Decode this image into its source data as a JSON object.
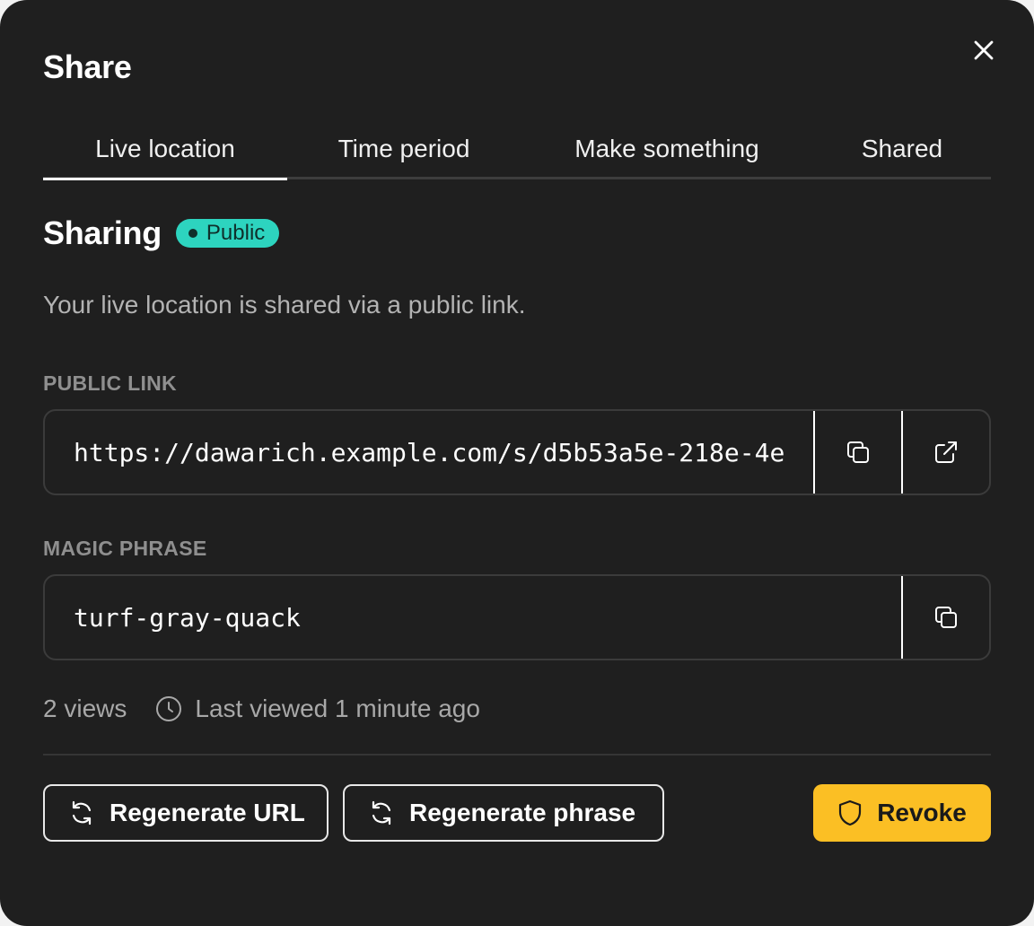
{
  "dialog": {
    "title": "Share"
  },
  "tabs": [
    {
      "label": "Live location",
      "active": true
    },
    {
      "label": "Time period",
      "active": false
    },
    {
      "label": "Make something",
      "active": false
    },
    {
      "label": "Shared",
      "active": false
    }
  ],
  "sharing": {
    "title": "Sharing",
    "badge": "Public",
    "badge_color": "#2dd4bf",
    "description": "Your live location is shared via a public link."
  },
  "public_link": {
    "label": "PUBLIC LINK",
    "value": "https://dawarich.example.com/s/d5b53a5e-218e-4e",
    "copy_icon": "copy-icon",
    "open_icon": "external-link-icon"
  },
  "magic_phrase": {
    "label": "MAGIC PHRASE",
    "value": "turf-gray-quack",
    "copy_icon": "copy-icon"
  },
  "stats": {
    "views": "2 views",
    "last_viewed": "Last viewed 1 minute ago",
    "clock_icon": "clock-icon"
  },
  "actions": {
    "regenerate_url": "Regenerate URL",
    "regenerate_phrase": "Regenerate phrase",
    "revoke": "Revoke",
    "revoke_color": "#fbbf24"
  }
}
